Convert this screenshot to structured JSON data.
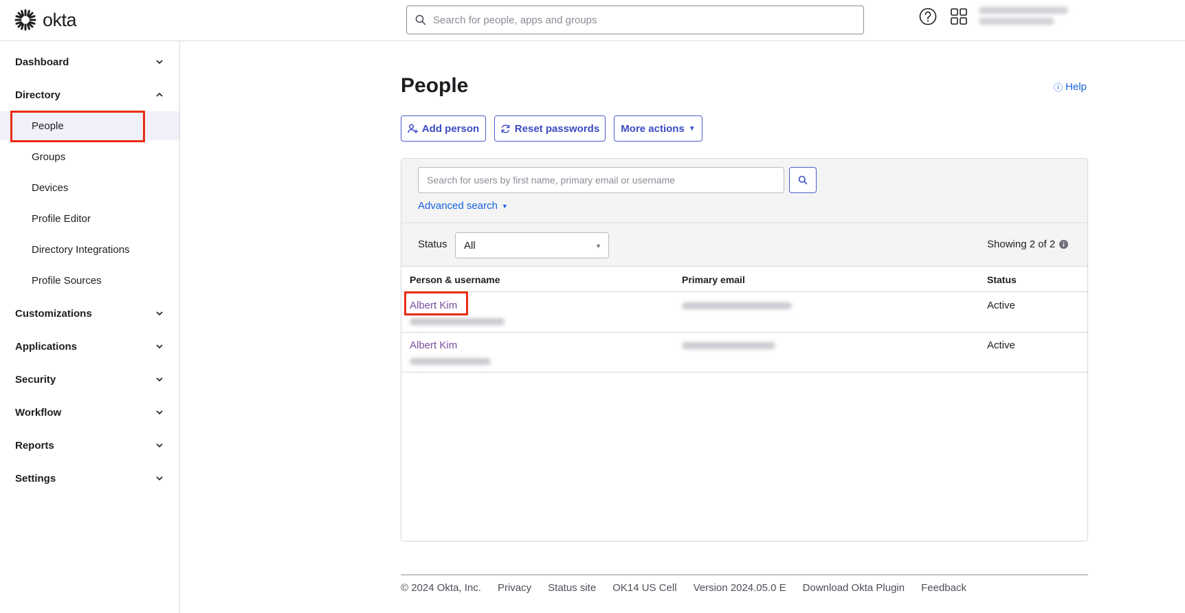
{
  "header": {
    "logo_text": "okta",
    "search_placeholder": "Search for people, apps and groups"
  },
  "sidebar": {
    "sections": [
      {
        "label": "Dashboard",
        "expanded": false
      },
      {
        "label": "Directory",
        "expanded": true
      },
      {
        "label": "Customizations",
        "expanded": false
      },
      {
        "label": "Applications",
        "expanded": false
      },
      {
        "label": "Security",
        "expanded": false
      },
      {
        "label": "Workflow",
        "expanded": false
      },
      {
        "label": "Reports",
        "expanded": false
      },
      {
        "label": "Settings",
        "expanded": false
      }
    ],
    "directory_items": [
      {
        "label": "People",
        "active": true
      },
      {
        "label": "Groups",
        "active": false
      },
      {
        "label": "Devices",
        "active": false
      },
      {
        "label": "Profile Editor",
        "active": false
      },
      {
        "label": "Directory Integrations",
        "active": false
      },
      {
        "label": "Profile Sources",
        "active": false
      }
    ]
  },
  "main": {
    "title": "People",
    "help_label": "Help",
    "buttons": {
      "add_person": "Add person",
      "reset_passwords": "Reset passwords",
      "more_actions": "More actions"
    },
    "user_search_placeholder": "Search for users by first name, primary email or username",
    "advanced_search": "Advanced search",
    "status_filter_label": "Status",
    "status_filter_value": "All",
    "showing": "Showing 2 of 2",
    "table": {
      "headers": [
        "Person & username",
        "Primary email",
        "Status"
      ],
      "rows": [
        {
          "name": "Albert Kim",
          "status": "Active"
        },
        {
          "name": "Albert Kim",
          "status": "Active"
        }
      ]
    }
  },
  "footer": {
    "copyright": "© 2024 Okta, Inc.",
    "links": [
      "Privacy",
      "Status site",
      "OK14 US Cell",
      "Version 2024.05.0 E",
      "Download Okta Plugin",
      "Feedback"
    ]
  },
  "colors": {
    "accent": "#3a4bc2",
    "link": "#1662dd",
    "visited_link": "#7a4d9e",
    "highlight": "#ea2b13"
  }
}
